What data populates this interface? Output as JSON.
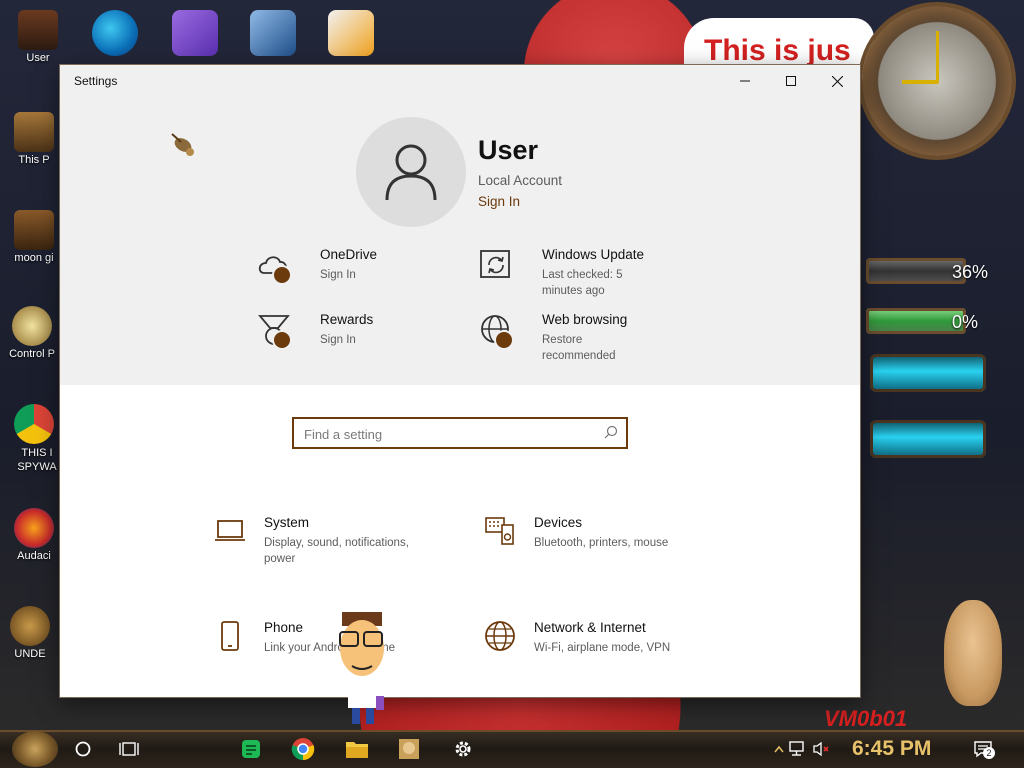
{
  "window": {
    "title": "Settings",
    "controls": {
      "minimize": "minimize",
      "maximize": "maximize",
      "close": "close"
    }
  },
  "account": {
    "name": "User",
    "type": "Local Account",
    "sign_in_link": "Sign In"
  },
  "services": [
    {
      "title": "OneDrive",
      "subtitle": "Sign In",
      "icon": "cloud-icon"
    },
    {
      "title": "Windows Update",
      "subtitle": "Last checked: 5 minutes ago",
      "icon": "sync-icon"
    },
    {
      "title": "Rewards",
      "subtitle": "Sign In",
      "icon": "medal-icon"
    },
    {
      "title": "Web browsing",
      "subtitle": "Restore recommended",
      "icon": "globe-icon"
    }
  ],
  "search": {
    "placeholder": "Find a setting"
  },
  "categories": [
    {
      "title": "System",
      "subtitle": "Display, sound, notifications, power",
      "icon": "laptop-icon"
    },
    {
      "title": "Devices",
      "subtitle": "Bluetooth, printers, mouse",
      "icon": "keyboard-speaker-icon"
    },
    {
      "title": "Phone",
      "subtitle": "Link your Android, iPhone",
      "icon": "phone-icon"
    },
    {
      "title": "Network & Internet",
      "subtitle": "Wi-Fi, airplane mode, VPN",
      "icon": "globe-icon"
    }
  ],
  "desktop": {
    "icons_left": [
      "User",
      "This P",
      "moon gi",
      "Control P",
      "THIS I SPYWA",
      "Audaci",
      "UNDE"
    ],
    "top_banner": "This is jus",
    "meters": [
      {
        "label": "36%",
        "value": 0.36
      },
      {
        "label": "0%",
        "value": 0.0
      }
    ],
    "watermark": "VM0b01"
  },
  "taskbar": {
    "clock": "6:45 PM",
    "notification_count": "2"
  },
  "colors": {
    "accent": "#6b3a0d",
    "window_bg": "#ffffff",
    "header_bg": "#f0f0f0"
  }
}
